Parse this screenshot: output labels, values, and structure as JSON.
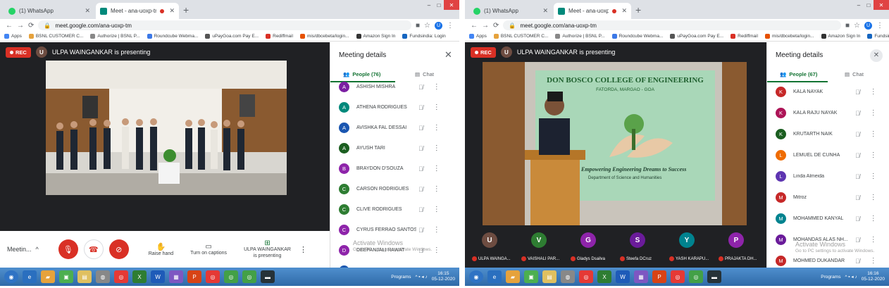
{
  "left": {
    "tabs": [
      {
        "title": "(1) WhatsApp",
        "color": "#25d366"
      },
      {
        "title": "Meet - ana-uoxp-tm",
        "color": "#00897b"
      }
    ],
    "url": "meet.google.com/ana-uoxp-tm",
    "bookmarks": [
      "Apps",
      "BSNL CUSTOMER C...",
      "Authorize | BSNL P...",
      "Roundcube Webma...",
      "uPayGoa.com Pay E...",
      "Rediffmail",
      "mis/dbcebeta/login...",
      "Amazon Sign In",
      "Fundsindia: Login"
    ],
    "rec_label": "REC",
    "presenter_initial": "U",
    "presenting_text": "ULPA WAINGANKAR is presenting",
    "panel": {
      "title": "Meeting details",
      "people_tab": "People (76)",
      "chat_tab": "Chat",
      "participants": [
        {
          "name": "ASHISH MISHRA",
          "initial": "A",
          "color": "#7b1fa2"
        },
        {
          "name": "ATHENA RODRIGUES",
          "initial": "A",
          "color": "#00897b"
        },
        {
          "name": "AVISHKA FAL DESSAI",
          "initial": "A",
          "color": "#1a56b0"
        },
        {
          "name": "AYUSH TARI",
          "initial": "A",
          "color": "#1b5e20"
        },
        {
          "name": "BRAYDON D'SOUZA",
          "initial": "B",
          "color": "#8e24aa"
        },
        {
          "name": "CARSON RODRIGUES",
          "initial": "C",
          "color": "#2e7d32"
        },
        {
          "name": "CLIVE RODRIGUES",
          "initial": "C",
          "color": "#2e7d32"
        },
        {
          "name": "CYRUS FERRAO SANTOS",
          "initial": "C",
          "color": "#8e24aa"
        },
        {
          "name": "DEEPANJALI RAWAT",
          "initial": "D",
          "color": "#8e24aa"
        },
        {
          "name": "DRUV TENDULKAR",
          "initial": "D",
          "color": "#1a56b0"
        }
      ]
    },
    "bottom": {
      "meeting_label": "Meetin...",
      "raise_hand": "Raise hand",
      "captions": "Turn on captions",
      "presenting_line1": "ULPA WAINGANKAR",
      "presenting_line2": "is presenting"
    },
    "watermark_title": "Activate Windows",
    "watermark_sub": "Go to PC settings to activate Windows.",
    "clock_time": "16:15",
    "clock_date": "05-12-2020",
    "tray_label": "Programs"
  },
  "right": {
    "tabs": [
      {
        "title": "(1) WhatsApp",
        "color": "#25d366"
      },
      {
        "title": "Meet - ana-uoxp-tm",
        "color": "#00897b"
      }
    ],
    "url": "meet.google.com/ana-uoxp-tm",
    "bookmarks": [
      "Apps",
      "BSNL CUSTOMER C...",
      "Authorize | BSNL P...",
      "Roundcube Webma...",
      "uPayGoa.com Pay E...",
      "Rediffmail",
      "mis/dbcebeta/login...",
      "Amazon Sign In",
      "Fundsindia: Login"
    ],
    "rec_label": "REC",
    "presenter_initial": "U",
    "presenting_text": "ULPA WAINGANKAR is presenting",
    "banner_title": "DON BOSCO COLLEGE OF ENGINEERING",
    "banner_sub": "FATORDA, MARGAO - GOA",
    "banner_tagline": "Empowering Engineering Dreams to Success",
    "banner_dept": "Department of Science and Humanities",
    "panel": {
      "title": "Meeting details",
      "people_tab": "People (67)",
      "chat_tab": "Chat",
      "participants": [
        {
          "name": "KALA NAYAK",
          "initial": "K",
          "color": "#c62828"
        },
        {
          "name": "KALA RAJU NAYAK",
          "initial": "K",
          "color": "#ad1457"
        },
        {
          "name": "KRUTARTH NAIK",
          "initial": "K",
          "color": "#1b5e20"
        },
        {
          "name": "LEMUEL DE CUNHA",
          "initial": "L",
          "color": "#ef6c00"
        },
        {
          "name": "Linda Almeida",
          "initial": "L",
          "color": "#5e35b1"
        },
        {
          "name": "Mitroz",
          "initial": "M",
          "color": "#c62828"
        },
        {
          "name": "MOHAMMED KANYAL",
          "initial": "M",
          "color": "#00838f"
        },
        {
          "name": "MOHANDAS ALAS NH...",
          "initial": "M",
          "color": "#6a1b9a"
        },
        {
          "name": "MOHMED DUKANDAR",
          "initial": "M",
          "color": "#c62828"
        }
      ]
    },
    "tiles": [
      {
        "initial": "U",
        "color": "#6d4c41",
        "name": "ULPA WAINGA..."
      },
      {
        "initial": "V",
        "color": "#2e7d32",
        "name": "VAISHALI PAR..."
      },
      {
        "initial": "G",
        "color": "#8e24aa",
        "name": "Gladys Dsailva"
      },
      {
        "initial": "S",
        "color": "#6a1b9a",
        "name": "Steefa DCruz"
      },
      {
        "initial": "Y",
        "color": "#00838f",
        "name": "YASH KARAPU..."
      },
      {
        "initial": "P",
        "color": "#8e24aa",
        "name": "PRAJAKTA DH..."
      }
    ],
    "watermark_title": "Activate Windows",
    "watermark_sub": "Go to PC settings to activate Windows.",
    "clock_time": "16:16",
    "clock_date": "05-12-2020",
    "tray_label": "Programs"
  }
}
